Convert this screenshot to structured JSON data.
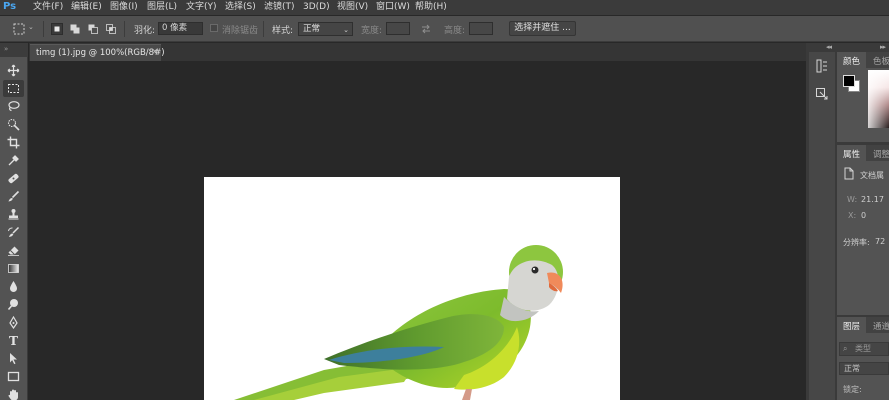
{
  "app": {
    "logo": "Ps"
  },
  "menu": [
    "文件(F)",
    "编辑(E)",
    "图像(I)",
    "图层(L)",
    "文字(Y)",
    "选择(S)",
    "滤镜(T)",
    "3D(D)",
    "视图(V)",
    "窗口(W)",
    "帮助(H)"
  ],
  "options_bar": {
    "feather_label": "羽化:",
    "feather_value": "0 像素",
    "antialias_label": "消除锯齿",
    "style_label": "样式:",
    "style_value": "正常",
    "width_label": "宽度:",
    "height_label": "高度:",
    "select_mask_button": "选择并遮住 ..."
  },
  "document": {
    "tab_title": "timg (1).jpg @ 100%(RGB/8#)",
    "close_glyph": "×"
  },
  "panels": {
    "color": {
      "tab_active": "颜色",
      "tab_inactive": "色板",
      "foreground": "#000000",
      "background": "#ffffff"
    },
    "properties": {
      "tab_active": "属性",
      "tab_inactive": "调整",
      "doc_label": "文档属",
      "width_label": "W:",
      "width_value": "21.17",
      "x_label": "X:",
      "x_value": "0",
      "resolution_label": "分辨率:",
      "resolution_value": "72"
    },
    "layers": {
      "tab_active": "图层",
      "tab_inactive": "通道",
      "search_placeholder": "类型",
      "blend_mode": "正常",
      "lock_label": "锁定:"
    }
  },
  "toolbar": {
    "tools": [
      "move-tool",
      "marquee-tool",
      "lasso-tool",
      "quick-selection-tool",
      "crop-tool",
      "eyedropper-tool",
      "healing-brush-tool",
      "brush-tool",
      "clone-stamp-tool",
      "history-brush-tool",
      "eraser-tool",
      "gradient-tool",
      "blur-tool",
      "dodge-tool",
      "pen-tool",
      "type-tool",
      "path-selection-tool",
      "rectangle-tool",
      "hand-tool"
    ],
    "type_tool_glyph": "T"
  },
  "colors": {
    "accent": "#4aa6f0",
    "workspace": "#282828",
    "panel": "#535353"
  }
}
